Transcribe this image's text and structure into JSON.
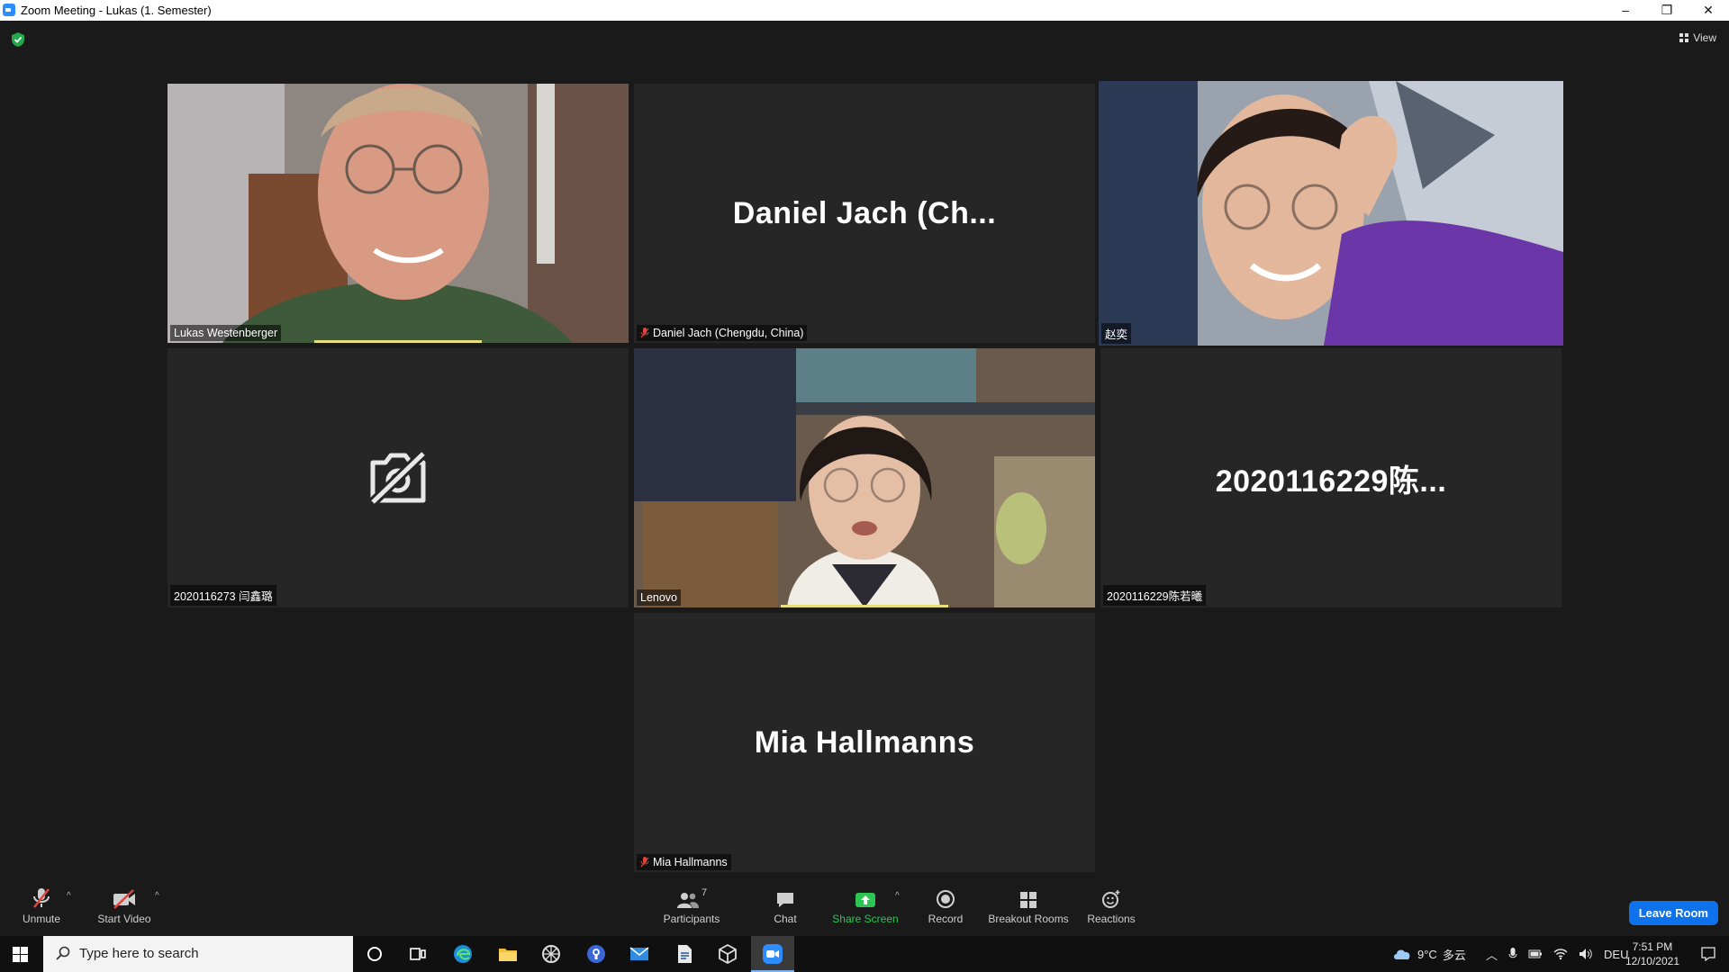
{
  "window": {
    "title": "Zoom Meeting - Lukas (1. Semester)",
    "controls": {
      "minimize": "–",
      "restore": "❐",
      "close": "✕"
    }
  },
  "header": {
    "view_label": "View"
  },
  "tiles": [
    {
      "name": "Lukas Westenberger",
      "muted": false,
      "video": true,
      "active": false
    },
    {
      "name": "Daniel Jach (Chengdu, China)",
      "display_name": "Daniel Jach  (Ch...",
      "muted": true,
      "video": false
    },
    {
      "name": "赵奕",
      "muted": false,
      "video": true,
      "active": true
    },
    {
      "name": "2020116273 闫鑫璐",
      "muted": false,
      "video": false,
      "camera_off_icon": true
    },
    {
      "name": "Lenovo",
      "muted": false,
      "video": true
    },
    {
      "name": "2020116229陈若曦",
      "display_name": "2020116229陈...",
      "muted": false,
      "video": false
    },
    {
      "name": "Mia Hallmanns",
      "display_name": "Mia Hallmanns",
      "muted": true,
      "video": false
    }
  ],
  "toolbar": {
    "unmute": "Unmute",
    "start_video": "Start Video",
    "participants": "Participants",
    "participants_count": "7",
    "chat": "Chat",
    "share_screen": "Share Screen",
    "record": "Record",
    "breakout_rooms": "Breakout Rooms",
    "reactions": "Reactions",
    "leave": "Leave Room",
    "caret": "^"
  },
  "taskbar": {
    "search_placeholder": "Type here to search",
    "weather": "9°C",
    "weather_desc": "多云",
    "lang": "DEU",
    "time": "7:51 PM",
    "date": "12/10/2021"
  },
  "colors": {
    "accent": "#0e72ed",
    "active_speaker": "#c6e84a",
    "share_green": "#2dc653"
  }
}
